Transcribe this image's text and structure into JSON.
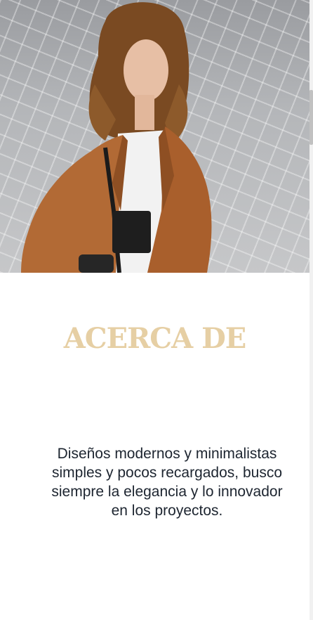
{
  "hero": {
    "image_alt": "Mujer con cabello rizado y chaqueta marrón"
  },
  "about": {
    "title": "ACERCA DE",
    "description": "Diseños modernos y minimalistas simples y pocos recargados, busco siempre la elegancia y lo innovador en los proyectos."
  },
  "colors": {
    "title": "#e6cfa4",
    "text": "#1d2530",
    "jacket": "#b26a35",
    "hair": "#7a4a22"
  }
}
